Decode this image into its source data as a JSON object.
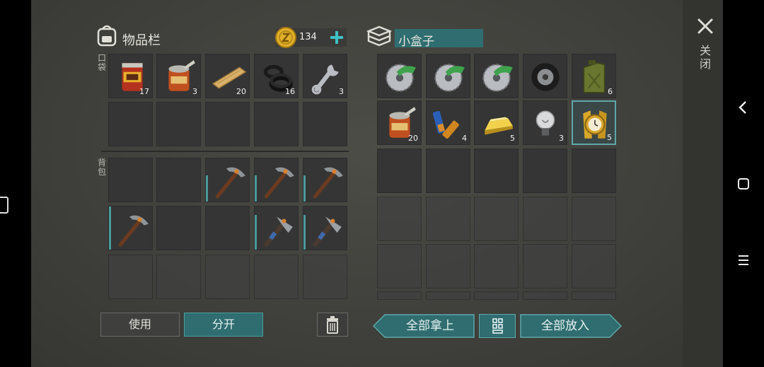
{
  "inventory": {
    "title": "物品栏",
    "coins": "134",
    "pocket_label": "口袋",
    "backpack_label": "背包",
    "pocket_items": [
      {
        "icon": "canned-food-icon",
        "count": "17"
      },
      {
        "icon": "opened-can-icon",
        "count": "3"
      },
      {
        "icon": "wood-plank-icon",
        "count": "20"
      },
      {
        "icon": "rubber-rings-icon",
        "count": "16"
      },
      {
        "icon": "wrench-icon",
        "count": "3"
      }
    ],
    "backpack_items": [
      {
        "icon": "pickaxe-icon",
        "durability": 0.6
      },
      {
        "icon": "pickaxe-icon",
        "durability": 0.6
      },
      {
        "icon": "pickaxe-icon",
        "durability": 0.6
      },
      {
        "icon": "pickaxe-icon",
        "durability": 1.0
      },
      {
        "icon": "hammer-icon",
        "durability": 0.8
      },
      {
        "icon": "hammer-icon",
        "durability": 0.8
      }
    ],
    "use_button": "使用",
    "split_button": "分开"
  },
  "container": {
    "title": "小盒子",
    "items": [
      {
        "icon": "saw-blade-icon",
        "count": ""
      },
      {
        "icon": "saw-blade-icon",
        "count": ""
      },
      {
        "icon": "saw-blade-icon",
        "count": ""
      },
      {
        "icon": "tire-icon",
        "count": ""
      },
      {
        "icon": "jerry-can-icon",
        "count": "6"
      },
      {
        "icon": "opened-can-icon",
        "count": "20"
      },
      {
        "icon": "batteries-icon",
        "count": "4"
      },
      {
        "icon": "gold-bar-icon",
        "count": "5"
      },
      {
        "icon": "light-bulb-icon",
        "count": "3"
      },
      {
        "icon": "gold-watch-icon",
        "count": "5"
      }
    ],
    "take_all_button": "全部拿上",
    "put_all_button": "全部放入"
  },
  "close_label": "关闭",
  "colors": {
    "accent": "#2f6d70",
    "accent_light": "#5fa7a8",
    "coin": "#e2b12a"
  }
}
